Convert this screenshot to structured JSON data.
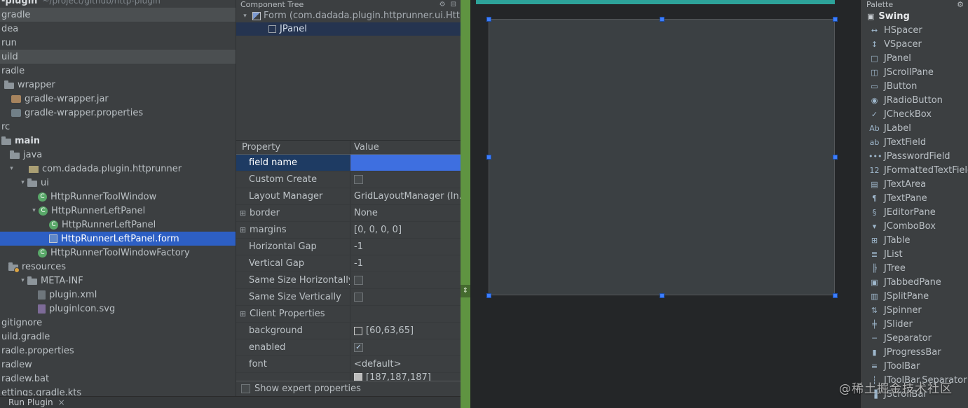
{
  "watermark": "@稀土掘金技术社区",
  "colors": {
    "panel_bg": "#3c3f41",
    "canvas_bg": "#242628",
    "panel_fill": "#3b4043",
    "selection": "#2d5fc4",
    "tree_unfocused_selection": "#253450",
    "property_selected_name_bg": "#1e3b63",
    "value_editor_blue": "#3e6fe0",
    "strip_green": "#5f9441",
    "strip_teal": "#2da39a",
    "handle_blue": "#3d7eff",
    "row_band": "#4b4f51",
    "text": "#bbbbbb"
  },
  "project": {
    "root_name": "-plugin",
    "root_path": "~/project/github/http-plugin",
    "items": [
      {
        "label": "gradle",
        "pad": 2,
        "icon": "none",
        "band": true
      },
      {
        "label": "dea",
        "pad": 2,
        "icon": "none"
      },
      {
        "label": "run",
        "pad": 2,
        "icon": "none"
      },
      {
        "label": "uild",
        "pad": 2,
        "icon": "none",
        "band": true
      },
      {
        "label": "radle",
        "pad": 2,
        "icon": "none"
      },
      {
        "label": "wrapper",
        "pad": 6,
        "icon": "folder"
      },
      {
        "label": "gradle-wrapper.jar",
        "pad": 16,
        "icon": "jar"
      },
      {
        "label": "gradle-wrapper.properties",
        "pad": 16,
        "icon": "properties"
      },
      {
        "label": "rc",
        "pad": 2,
        "icon": "none"
      },
      {
        "label": "main",
        "pad": 2,
        "icon": "folder",
        "bold": true
      },
      {
        "label": "java",
        "pad": 14,
        "icon": "folder"
      },
      {
        "label": "com.dadada.plugin.httprunner",
        "pad": 10,
        "chevron": true,
        "gap": 18,
        "icon": "package"
      },
      {
        "label": "ui",
        "pad": 26,
        "chevron": true,
        "icon": "folder"
      },
      {
        "label": "HttpRunnerToolWindow",
        "pad": 54,
        "icon": "class"
      },
      {
        "label": "HttpRunnerLeftPanel",
        "pad": 42,
        "chevron": true,
        "icon": "class"
      },
      {
        "label": "HttpRunnerLeftPanel",
        "pad": 70,
        "icon": "class"
      },
      {
        "label": "HttpRunnerLeftPanel.form",
        "pad": 70,
        "icon": "form",
        "selected": true
      },
      {
        "label": "HttpRunnerToolWindowFactory",
        "pad": 54,
        "icon": "class"
      },
      {
        "label": "resources",
        "pad": 12,
        "icon": "folder-badge"
      },
      {
        "label": "META-INF",
        "pad": 26,
        "chevron": true,
        "icon": "folder"
      },
      {
        "label": "plugin.xml",
        "pad": 54,
        "icon": "xml"
      },
      {
        "label": "pluginIcon.svg",
        "pad": 54,
        "icon": "svg"
      },
      {
        "label": "gitignore",
        "pad": 2,
        "icon": "none"
      },
      {
        "label": "uild.gradle",
        "pad": 2,
        "icon": "none"
      },
      {
        "label": "radle.properties",
        "pad": 2,
        "icon": "none"
      },
      {
        "label": "radlew",
        "pad": 2,
        "icon": "none"
      },
      {
        "label": "radlew.bat",
        "pad": 2,
        "icon": "none"
      },
      {
        "label": "ettings.gradle.kts",
        "pad": 2,
        "icon": "none"
      }
    ]
  },
  "component_tree": {
    "title": "Component Tree",
    "rows": [
      {
        "label": "Form (com.dadada.plugin.httprunner.ui.HttpR",
        "icon": "formfile",
        "chevron": true,
        "pad": 6
      },
      {
        "label": "JPanel",
        "icon": "panel",
        "selected": true,
        "pad": 44
      }
    ]
  },
  "properties": {
    "header": {
      "property": "Property",
      "value": "Value"
    },
    "rows": [
      {
        "name": "field name",
        "type": "name-editor",
        "selected": true
      },
      {
        "name": "Custom Create",
        "type": "checkbox",
        "checked": false
      },
      {
        "name": "Layout Manager",
        "type": "text",
        "value": "GridLayoutManager (In..."
      },
      {
        "name": "border",
        "type": "text",
        "value": "None",
        "expand": true
      },
      {
        "name": "margins",
        "type": "text",
        "value": "[0, 0, 0, 0]",
        "expand": true
      },
      {
        "name": "Horizontal Gap",
        "type": "text",
        "value": "-1"
      },
      {
        "name": "Vertical Gap",
        "type": "text",
        "value": "-1"
      },
      {
        "name": "Same Size Horizontally",
        "type": "checkbox",
        "checked": false
      },
      {
        "name": "Same Size Vertically",
        "type": "checkbox",
        "checked": false
      },
      {
        "name": "Client Properties",
        "type": "text",
        "value": "",
        "expand": true
      },
      {
        "name": "background",
        "type": "swatch",
        "value": "[60,63,65]",
        "swatch": "#3c3f41"
      },
      {
        "name": "enabled",
        "type": "checkbox",
        "checked": true
      },
      {
        "name": "font",
        "type": "text",
        "value": "<default>"
      },
      {
        "name": "",
        "type": "swatch",
        "value": "[187,187,187]",
        "swatch": "#bbbbbb",
        "clipped": true
      }
    ],
    "footer": {
      "label": "Show expert properties",
      "checked": false
    }
  },
  "debug": {
    "tab": "Run Plugin"
  },
  "palette": {
    "title": "Palette",
    "group": "Swing",
    "items": [
      {
        "label": "HSpacer",
        "icon": "hspacer-icon",
        "glyph": "↔"
      },
      {
        "label": "VSpacer",
        "icon": "vspacer-icon",
        "glyph": "↕"
      },
      {
        "label": "JPanel",
        "icon": "jpanel-icon",
        "glyph": "□"
      },
      {
        "label": "JScrollPane",
        "icon": "jscrollpane-icon",
        "glyph": "◫"
      },
      {
        "label": "JButton",
        "icon": "jbutton-icon",
        "glyph": "▭"
      },
      {
        "label": "JRadioButton",
        "icon": "jradiobutton-icon",
        "glyph": "◉"
      },
      {
        "label": "JCheckBox",
        "icon": "jcheckbox-icon",
        "glyph": "✓"
      },
      {
        "label": "JLabel",
        "icon": "jlabel-icon",
        "glyph": "Ab"
      },
      {
        "label": "JTextField",
        "icon": "jtextfield-icon",
        "glyph": "ab"
      },
      {
        "label": "JPasswordField",
        "icon": "jpasswordfield-icon",
        "glyph": "•••"
      },
      {
        "label": "JFormattedTextField",
        "icon": "jformattedtextfield-icon",
        "glyph": "12"
      },
      {
        "label": "JTextArea",
        "icon": "jtextarea-icon",
        "glyph": "▤"
      },
      {
        "label": "JTextPane",
        "icon": "jtextpane-icon",
        "glyph": "¶"
      },
      {
        "label": "JEditorPane",
        "icon": "jeditorpane-icon",
        "glyph": "§"
      },
      {
        "label": "JComboBox",
        "icon": "jcombobox-icon",
        "glyph": "▾"
      },
      {
        "label": "JTable",
        "icon": "jtable-icon",
        "glyph": "⊞"
      },
      {
        "label": "JList",
        "icon": "jlist-icon",
        "glyph": "≣"
      },
      {
        "label": "JTree",
        "icon": "jtree-icon",
        "glyph": "╠"
      },
      {
        "label": "JTabbedPane",
        "icon": "jtabbedpane-icon",
        "glyph": "▣"
      },
      {
        "label": "JSplitPane",
        "icon": "jsplitpane-icon",
        "glyph": "▥"
      },
      {
        "label": "JSpinner",
        "icon": "jspinner-icon",
        "glyph": "⇅"
      },
      {
        "label": "JSlider",
        "icon": "jslider-icon",
        "glyph": "╪"
      },
      {
        "label": "JSeparator",
        "icon": "jseparator-icon",
        "glyph": "─"
      },
      {
        "label": "JProgressBar",
        "icon": "jprogressbar-icon",
        "glyph": "▮"
      },
      {
        "label": "JToolBar",
        "icon": "jtoolbar-icon",
        "glyph": "≡"
      },
      {
        "label": "JToolBar.Separator",
        "icon": "jtoolbar-separator-icon",
        "glyph": "┆"
      },
      {
        "label": "JScrollBar",
        "icon": "jscrollbar-icon",
        "glyph": "▐"
      }
    ]
  }
}
